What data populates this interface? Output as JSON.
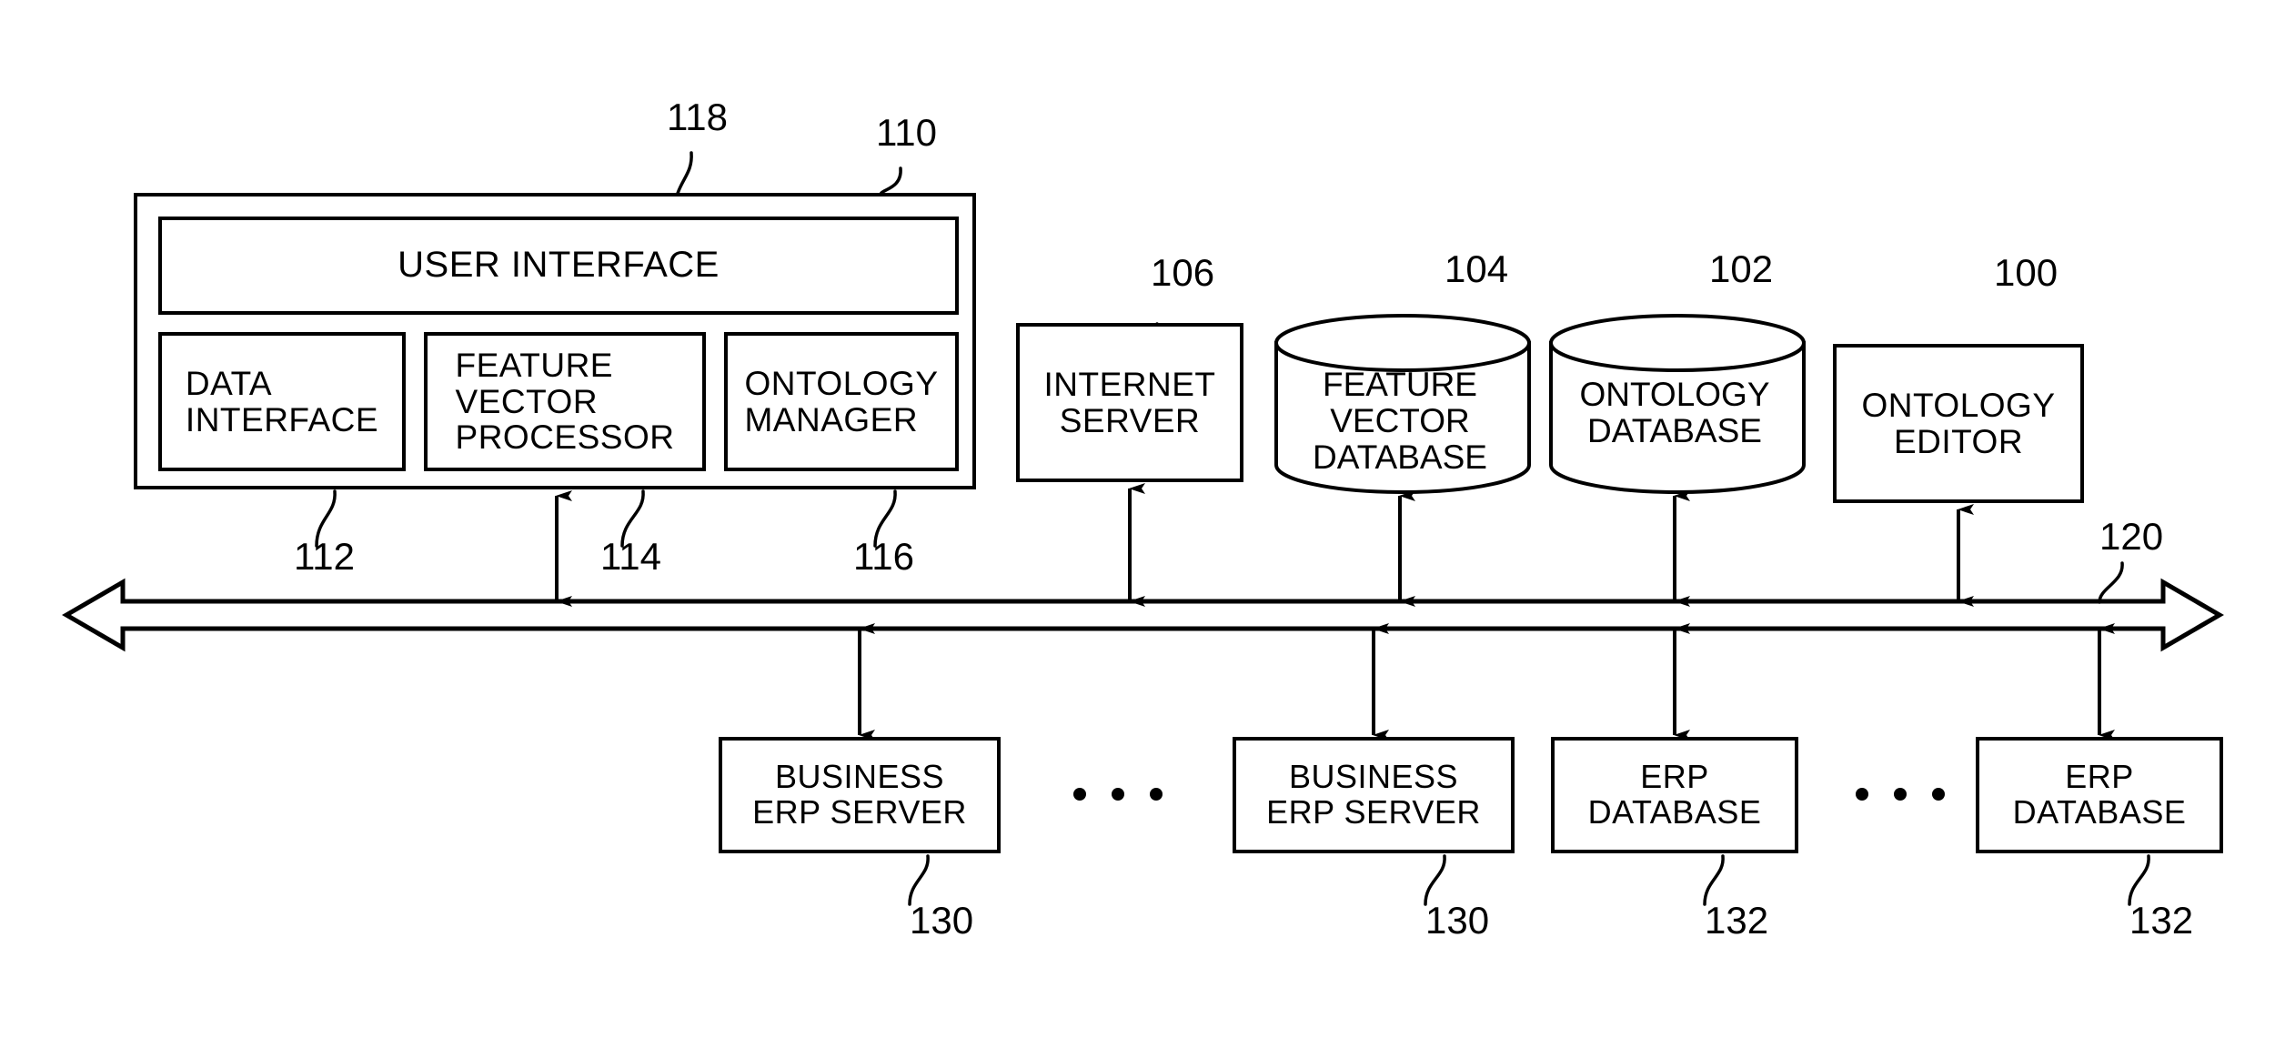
{
  "figure": {
    "type": "patent-system-block-diagram",
    "background_color": "#ffffff",
    "line_color": "#000000"
  },
  "system_module": {
    "ref": "110",
    "user_interface": {
      "label": "USER INTERFACE",
      "ref": "118"
    },
    "sub_modules": [
      {
        "label": "DATA\nINTERFACE",
        "ref": "112"
      },
      {
        "label": "FEATURE\nVECTOR\nPROCESSOR",
        "ref": "114"
      },
      {
        "label": "ONTOLOGY\nMANAGER",
        "ref": "116"
      }
    ]
  },
  "top_nodes": [
    {
      "label": "INTERNET\nSERVER",
      "ref": "106",
      "shape": "box"
    },
    {
      "label": "FEATURE\nVECTOR\nDATABASE",
      "ref": "104",
      "shape": "cylinder"
    },
    {
      "label": "ONTOLOGY\nDATABASE",
      "ref": "102",
      "shape": "cylinder"
    },
    {
      "label": "ONTOLOGY\nEDITOR",
      "ref": "100",
      "shape": "box"
    }
  ],
  "bus": {
    "ref": "120",
    "style": "double-headed-hollow-arrow"
  },
  "bottom_nodes": [
    {
      "label": "BUSINESS\nERP SERVER",
      "ref": "130",
      "shape": "box"
    },
    {
      "label": "BUSINESS\nERP SERVER",
      "ref": "130",
      "shape": "box"
    },
    {
      "label": "ERP\nDATABASE",
      "ref": "132",
      "shape": "box"
    },
    {
      "label": "ERP\nDATABASE",
      "ref": "132",
      "shape": "box"
    }
  ],
  "ellipses": [
    {
      "position": "between-business-erp-servers",
      "dots": 3
    },
    {
      "position": "between-erp-databases",
      "dots": 3
    }
  ]
}
